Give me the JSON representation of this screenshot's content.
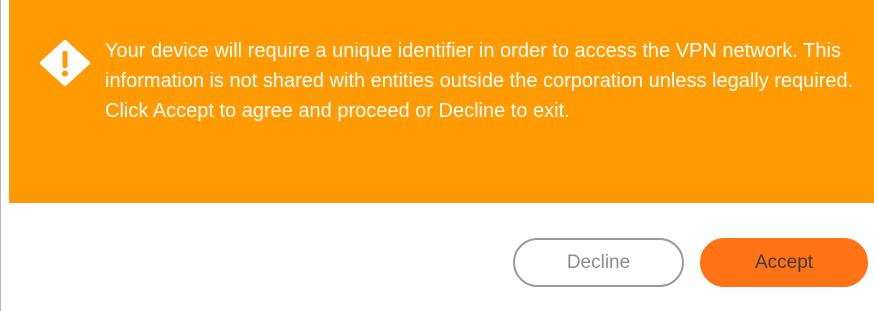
{
  "dialog": {
    "message": "Your device will require a unique identifier in order to access the VPN network. This information is not shared with entities outside the corporation unless legally required. Click Accept to agree and proceed or Decline to exit.",
    "icon": "warning-diamond-icon",
    "banner_color": "#ff9a00",
    "accent_color": "#ff7215",
    "buttons": {
      "decline_label": "Decline",
      "accept_label": "Accept"
    }
  }
}
